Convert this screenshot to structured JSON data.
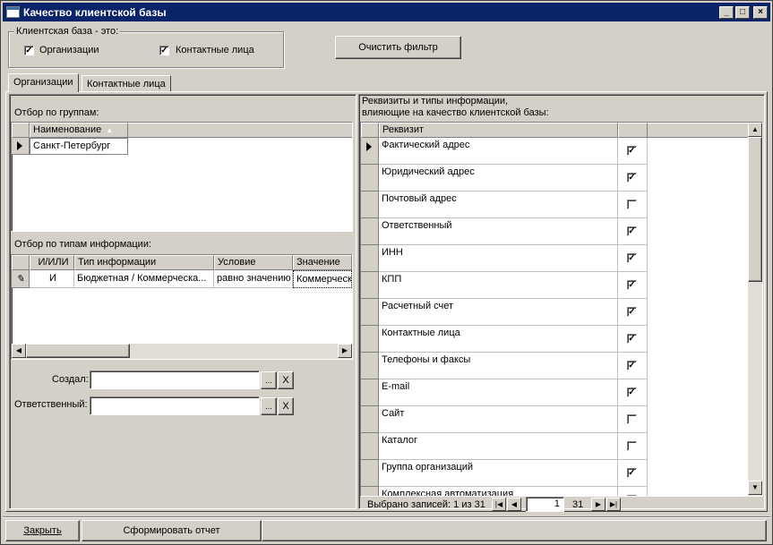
{
  "window": {
    "title": "Качество клиентской базы",
    "min_label": "_",
    "max_label": "□",
    "close_label": "×"
  },
  "group": {
    "caption": "Клиентская база - это:",
    "cb_org_label": "Организации",
    "cb_contact_label": "Контактные лица",
    "cb_org_checked": true,
    "cb_contact_checked": true
  },
  "clear_filter_label": "Очистить фильтр",
  "tabs": [
    {
      "label": "Организации"
    },
    {
      "label": "Контактные лица"
    }
  ],
  "left": {
    "groups_caption": "Отбор по группам:",
    "groups_header": "Наименование",
    "groups_sort_glyph": "▲",
    "groups_rows": [
      {
        "name": "Санкт-Петербург"
      }
    ],
    "types_caption": "Отбор по типам информации:",
    "types_headers": {
      "andor": "И/ИЛИ",
      "type": "Тип информации",
      "cond": "Условие",
      "value": "Значение"
    },
    "types_rows": [
      {
        "andor": "И",
        "type": "Бюджетная / Коммерческа...",
        "cond": "равно значению",
        "value": "Коммерческ"
      }
    ],
    "created_label": "Создал:",
    "created_value": "",
    "responsible_label": "Ответственный:",
    "responsible_value": "",
    "ellipsis": "...",
    "clear_x": "X"
  },
  "right": {
    "caption_line1": "Реквизиты и типы информации,",
    "caption_line2": "влияющие на качество клиентской базы:",
    "header": "Реквизит",
    "rows": [
      {
        "name": "Фактический адрес",
        "checked": true
      },
      {
        "name": "Юридический адрес",
        "checked": true
      },
      {
        "name": "Почтовый адрес",
        "checked": false
      },
      {
        "name": "Ответственный",
        "checked": true
      },
      {
        "name": "ИНН",
        "checked": true
      },
      {
        "name": "КПП",
        "checked": true
      },
      {
        "name": "Расчетный счет",
        "checked": true
      },
      {
        "name": "Контактные лица",
        "checked": true
      },
      {
        "name": "Телефоны и факсы",
        "checked": true
      },
      {
        "name": "E-mail",
        "checked": true
      },
      {
        "name": "Сайт",
        "checked": false
      },
      {
        "name": "Каталог",
        "checked": false
      },
      {
        "name": "Группа организаций",
        "checked": true
      },
      {
        "name": "Комплексная автоматизация",
        "checked": false
      }
    ],
    "status_text": "Выбрано записей: 1 из 31",
    "page_current": "1",
    "page_total": "31"
  },
  "bottom": {
    "close_label": "Закрыть",
    "report_label": "Сформировать отчет"
  }
}
